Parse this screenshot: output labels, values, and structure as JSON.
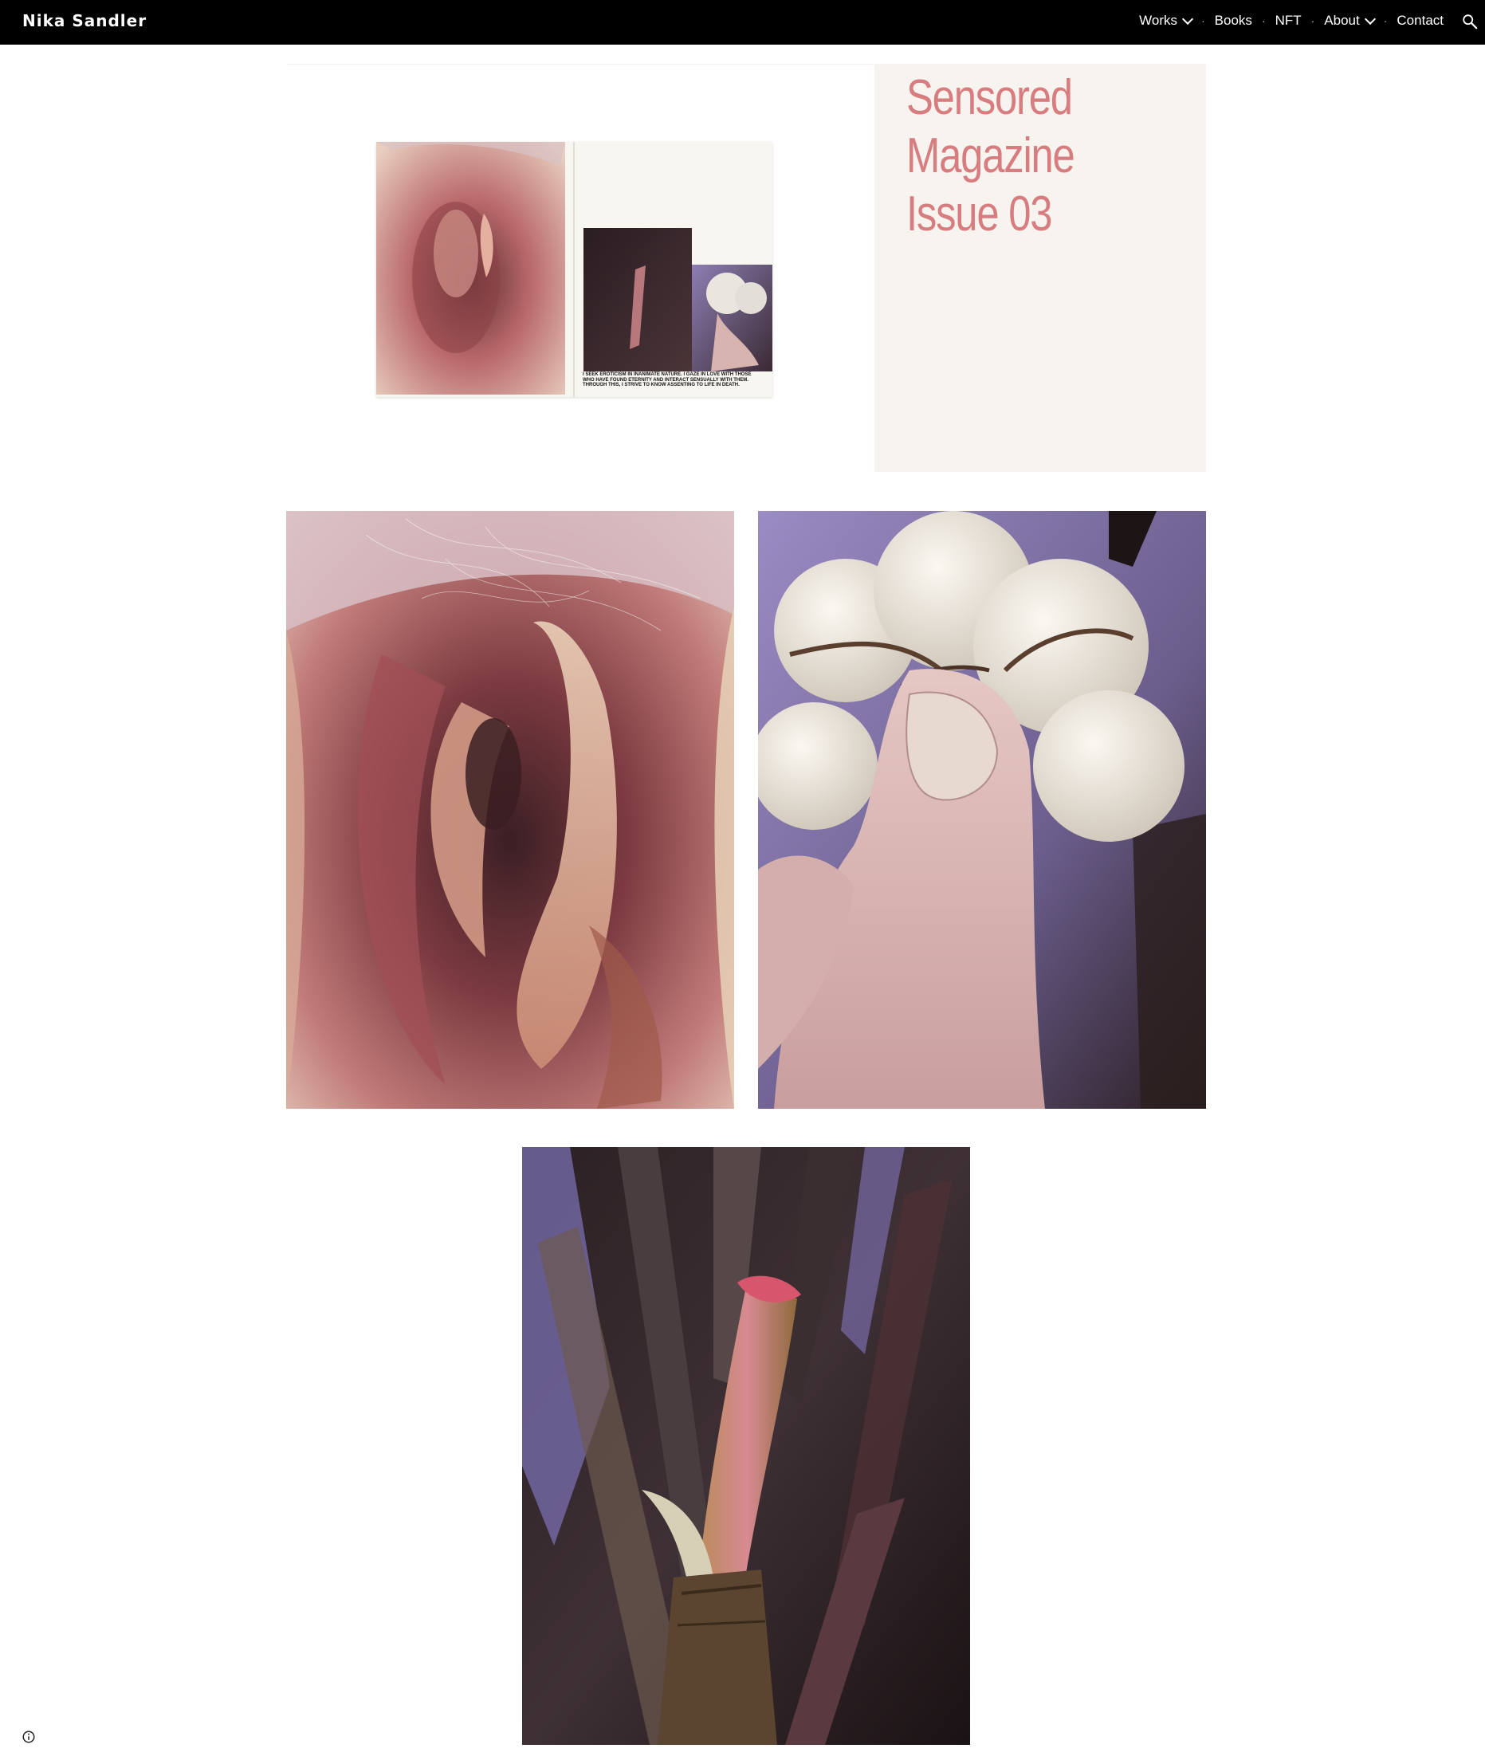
{
  "site": {
    "title": "Nika Sandler"
  },
  "nav": {
    "items": [
      {
        "label": "Works",
        "has_dropdown": true
      },
      {
        "label": "Books",
        "has_dropdown": false
      },
      {
        "label": "NFT",
        "has_dropdown": false
      },
      {
        "label": "About",
        "has_dropdown": true
      },
      {
        "label": "Contact",
        "has_dropdown": false
      }
    ],
    "separator": "·"
  },
  "feature": {
    "title_lines": [
      "Sensored",
      "Magazine",
      "Issue 03"
    ],
    "title_color": "#d77d80",
    "panel_color": "#f7f3ef",
    "spread_caption": "I seek eroticism in inanimate nature. I gaze in love with those who have found eternity and interact sensually with them. Through this, I strive to know assenting to life in death."
  },
  "gallery": [
    {
      "name": "rose-photo",
      "subject": "dried rose macro"
    },
    {
      "name": "cotton-toe-photo",
      "subject": "cotton boll held between toes"
    },
    {
      "name": "stem-photo",
      "subject": "broken pink stem among dark leaves"
    }
  ],
  "icons": {
    "search": "search-icon",
    "info": "info-icon",
    "dropdown": "chevron-down-icon"
  },
  "colors": {
    "topbar": "#000000",
    "background": "#ffffff",
    "accent": "#d77d80"
  }
}
